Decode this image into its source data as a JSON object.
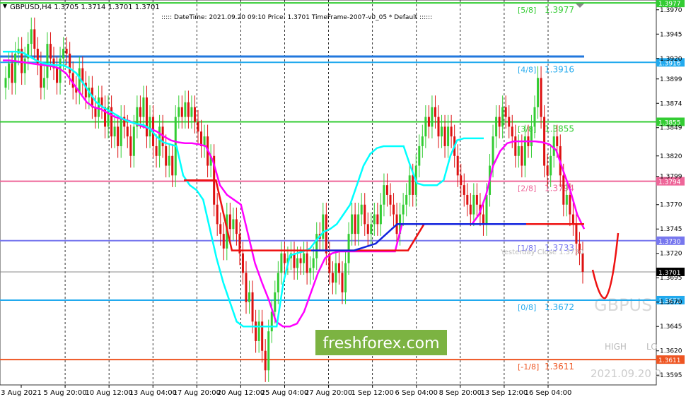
{
  "chart_data": {
    "type": "candlestick",
    "title": "GBPUSD,H4  1.3705 1.3714 1.3701 1.3701",
    "header_info": ":::::  DateTime: 2021.09.20 09:10    Price: 1.3701    TimeFrame-2007-v0_05    *    Default    ::::::",
    "symbol_watermark": "GBPUS",
    "timestamp_watermark": "2021.09.20 0",
    "high_label": "HIGH",
    "low_label": "LO",
    "brand": "freshforex.com",
    "yesterday_label": "Yesterday Close 1.3730",
    "ylim": [
      1.3585,
      1.398
    ],
    "price_ticks": [
      "1.3970",
      "1.3945",
      "1.3920",
      "1.3899",
      "1.3874",
      "1.3849",
      "1.3820",
      "1.3799",
      "1.3770",
      "1.3745",
      "1.3720",
      "1.3695",
      "1.3670",
      "1.3645",
      "1.3620",
      "1.3595"
    ],
    "time_labels": [
      "3 Aug 2021",
      "5 Aug 20:00",
      "10 Aug 12:00",
      "13 Aug 04:00",
      "17 Aug 20:00",
      "20 Aug 12:00",
      "25 Aug 04:00",
      "27 Aug 20:00",
      "1 Sep 12:00",
      "6 Sep 04:00",
      "8 Sep 20:00",
      "13 Sep 12:00",
      "16 Sep 04:00"
    ],
    "levels": [
      {
        "name": "[5/8]",
        "value": 1.3977,
        "value_text": "1.3977",
        "badge": "1.3977",
        "color": "#33cc33"
      },
      {
        "name": "[4/8]",
        "value": 1.3916,
        "value_text": "1.3916",
        "badge": "1.3916",
        "color": "#22aaee"
      },
      {
        "name": "[3/8]",
        "value": 1.3855,
        "value_text": "1.3855",
        "badge": "1.3855",
        "color": "#33cc33"
      },
      {
        "name": "[2/8]",
        "value": 1.3794,
        "value_text": "1.3794",
        "badge": "1.3794",
        "color": "#ee6699"
      },
      {
        "name": "[1/8]",
        "value": 1.3733,
        "value_text": "1.3733",
        "badge": "1.3730",
        "color": "#7777ee"
      },
      {
        "name": "",
        "value": 1.3701,
        "value_text": "",
        "badge": "1.3701",
        "color": "#888888"
      },
      {
        "name": "[0/8]",
        "value": 1.3672,
        "value_text": "1.3672",
        "badge": "1.3672",
        "color": "#22aaee"
      },
      {
        "name": "[-1/8]",
        "value": 1.3611,
        "value_text": "1.3611",
        "badge": "1.3611",
        "color": "#ee5522"
      }
    ],
    "candle_closes": [
      1.39,
      1.3915,
      1.3895,
      1.3925,
      1.393,
      1.3905,
      1.392,
      1.3935,
      1.395,
      1.393,
      1.3915,
      1.389,
      1.39,
      1.3935,
      1.392,
      1.391,
      1.3895,
      1.392,
      1.393,
      1.3925,
      1.3905,
      1.389,
      1.3885,
      1.391,
      1.3895,
      1.388,
      1.389,
      1.387,
      1.386,
      1.388,
      1.387,
      1.385,
      1.387,
      1.384,
      1.385,
      1.383,
      1.386,
      1.385,
      1.384,
      1.382,
      1.385,
      1.387,
      1.386,
      1.388,
      1.384,
      1.386,
      1.383,
      1.382,
      1.385,
      1.383,
      1.381,
      1.382,
      1.38,
      1.386,
      1.387,
      1.386,
      1.3875,
      1.386,
      1.387,
      1.3855,
      1.3845,
      1.383,
      1.384,
      1.381,
      1.382,
      1.377,
      1.375,
      1.374,
      1.3725,
      1.376,
      1.3745,
      1.3755,
      1.374,
      1.372,
      1.37,
      1.367,
      1.368,
      1.365,
      1.363,
      1.365,
      1.362,
      1.36,
      1.364,
      1.366,
      1.368,
      1.37,
      1.372,
      1.371,
      1.3715,
      1.372,
      1.3705,
      1.3715,
      1.371,
      1.372,
      1.37,
      1.3705,
      1.3715,
      1.374,
      1.3735,
      1.376,
      1.372,
      1.37,
      1.369,
      1.371,
      1.37,
      1.368,
      1.371,
      1.374,
      1.376,
      1.374,
      1.376,
      1.377,
      1.375,
      1.374,
      1.375,
      1.376,
      1.375,
      1.377,
      1.379,
      1.378,
      1.377,
      1.376,
      1.374,
      1.376,
      1.377,
      1.378,
      1.38,
      1.378,
      1.381,
      1.383,
      1.384,
      1.386,
      1.385,
      1.387,
      1.386,
      1.384,
      1.385,
      1.383,
      1.385,
      1.384,
      1.382,
      1.38,
      1.379,
      1.378,
      1.377,
      1.376,
      1.378,
      1.377,
      1.376,
      1.375,
      1.378,
      1.381,
      1.384,
      1.386,
      1.385,
      1.387,
      1.386,
      1.385,
      1.384,
      1.382,
      1.383,
      1.381,
      1.384,
      1.383,
      1.385,
      1.387,
      1.39,
      1.386,
      1.381,
      1.38,
      1.382,
      1.384,
      1.383,
      1.38,
      1.377,
      1.378,
      1.376,
      1.375,
      1.373,
      1.372,
      1.3701
    ],
    "series": [
      {
        "name": "",
        "color": "#ff00ff",
        "values": [
          1.3918,
          1.3918,
          1.3917,
          1.3916,
          1.3915,
          1.3914,
          1.3913,
          1.3912,
          1.391,
          1.3905,
          1.3895,
          1.3885,
          1.3875,
          1.387,
          1.3868,
          1.3864,
          1.386,
          1.3858,
          1.3856,
          1.3853,
          1.385,
          1.3848,
          1.3845,
          1.384,
          1.3836,
          1.3834,
          1.3833,
          1.3833,
          1.3832,
          1.383,
          1.3815,
          1.379,
          1.378,
          1.3775,
          1.377,
          1.374,
          1.371,
          1.369,
          1.3672,
          1.365,
          1.3645,
          1.3645,
          1.3648,
          1.366,
          1.368,
          1.37,
          1.3715,
          1.372,
          1.3722,
          1.3722,
          1.3722,
          1.3722,
          1.3722,
          1.3722,
          1.3722,
          1.3722,
          1.3722,
          1.375,
          1.375,
          1.375,
          1.375,
          1.375,
          1.375,
          1.375,
          1.375,
          1.375,
          1.375,
          1.375,
          1.376,
          1.378,
          1.381,
          1.3825,
          1.3833,
          1.3835,
          1.3835,
          1.3835,
          1.3835,
          1.3834,
          1.3832,
          1.3826,
          1.3805,
          1.3785,
          1.376,
          1.3745
        ]
      },
      {
        "name": "",
        "color": "#00ffff",
        "values": [
          1.3927,
          1.3927,
          1.3927,
          1.3926,
          1.3922,
          1.3918,
          1.3915,
          1.3914,
          1.3913,
          1.3913,
          1.391,
          1.3905,
          1.3895,
          1.3885,
          1.3875,
          1.387,
          1.3866,
          1.3862,
          1.3858,
          1.3855,
          1.3853,
          1.3852,
          1.3848,
          1.384,
          1.3834,
          1.3832,
          1.383,
          1.38,
          1.379,
          1.3785,
          1.3775,
          1.3745,
          1.3715,
          1.369,
          1.367,
          1.365,
          1.3645,
          1.3645,
          1.3645,
          1.3645,
          1.3645,
          1.3645,
          1.369,
          1.3718,
          1.372,
          1.3722,
          1.3725,
          1.3734,
          1.3742,
          1.3745,
          1.375,
          1.376,
          1.377,
          1.379,
          1.381,
          1.3822,
          1.3828,
          1.383,
          1.383,
          1.383,
          1.383,
          1.381,
          1.3792,
          1.379,
          1.379,
          1.379,
          1.3795,
          1.382,
          1.3836,
          1.3838,
          1.3838,
          1.3838,
          1.3838
        ]
      },
      {
        "name": "",
        "color": "#ee1111",
        "values": [
          1.3795,
          1.3795,
          1.3795,
          1.3723,
          1.3723,
          1.3723,
          1.3723,
          1.3723,
          1.3723,
          1.3723,
          1.3723,
          1.3723,
          1.3723,
          1.3723,
          1.3723,
          1.375,
          1.375,
          1.375,
          1.375,
          1.375,
          1.375,
          1.375,
          1.375,
          1.375,
          1.375,
          1.375
        ]
      },
      {
        "name": "",
        "color": "#1122dd",
        "values": [
          1.3723,
          1.3723,
          1.3723,
          1.373,
          1.375,
          1.375,
          1.375,
          1.375,
          1.375,
          1.375,
          1.375
        ]
      }
    ]
  }
}
